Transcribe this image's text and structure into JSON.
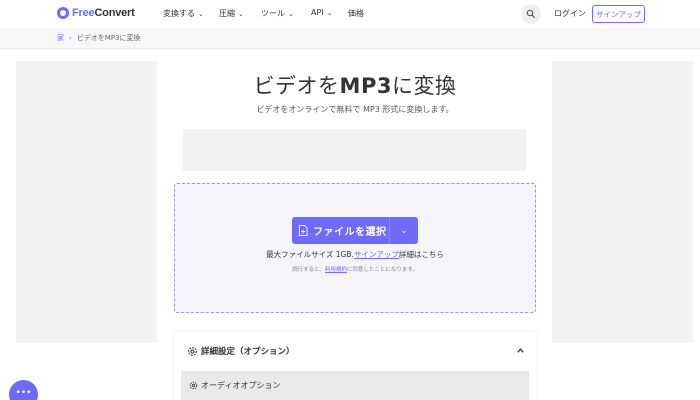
{
  "brand": {
    "name_free": "Free",
    "name_convert": "Convert",
    "accent": "#6f6af8"
  },
  "nav": {
    "convert": "変換する",
    "compress": "圧縮",
    "tools": "ツール",
    "api": "API",
    "pricing": "価格",
    "login": "ログイン",
    "signup": "サインアップ"
  },
  "breadcrumb": {
    "home": "家",
    "current": "ビデオをMP3に変換"
  },
  "hero": {
    "title_a": "ビデオを",
    "title_b": "MP3",
    "title_c": "に変換",
    "subtitle": "ビデオをオンラインで無料で MP3 形式に変換します。"
  },
  "upload": {
    "choose_label": "ファイルを選択",
    "max_prefix": "最大ファイルサイズ 1GB.",
    "max_link": "サインアップ",
    "max_suffix": "詳細はこちら",
    "terms_prefix": "続行すると、",
    "terms_link": "利用規約",
    "terms_suffix": "に同意したことになります。"
  },
  "advanced": {
    "title": "詳細設定（オプション）",
    "audio_options": "オーディオオプション"
  },
  "icons": {
    "search": "search-icon",
    "file": "file-icon",
    "gear": "gear-icon",
    "chat": "chat-icon"
  }
}
